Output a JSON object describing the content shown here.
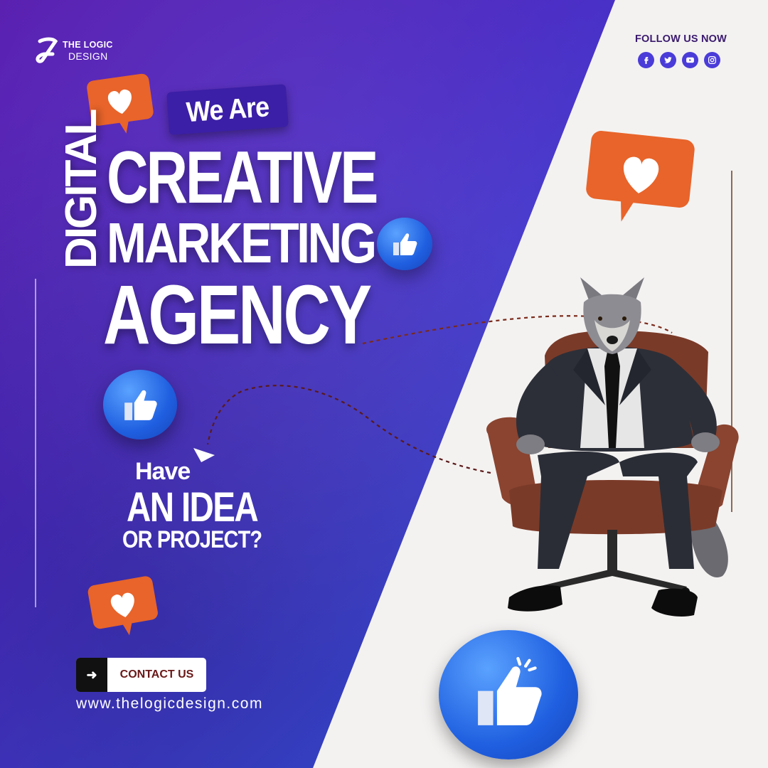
{
  "brand": {
    "line1": "THE LOGIC",
    "line2": "DESIGN"
  },
  "follow": {
    "label": "FOLLOW US NOW",
    "icons": [
      "facebook-icon",
      "twitter-icon",
      "youtube-icon",
      "instagram-icon"
    ]
  },
  "headline": {
    "tag": "We Are",
    "vertical": "DIGITAL",
    "line1": "CREATIVE",
    "line2": "MARKETING",
    "line3": "AGENCY"
  },
  "question": {
    "line1": "Have",
    "line2": "AN IDEA",
    "line3": "OR PROJECT?"
  },
  "cta": {
    "label": "CONTACT US",
    "icon": "arrow-right-icon"
  },
  "website": "www.thelogicdesign.com",
  "colors": {
    "primary": "#4a2bc4",
    "accent": "#e8642a",
    "text_dark": "#3a1a6e",
    "cta_text": "#6a1818"
  }
}
